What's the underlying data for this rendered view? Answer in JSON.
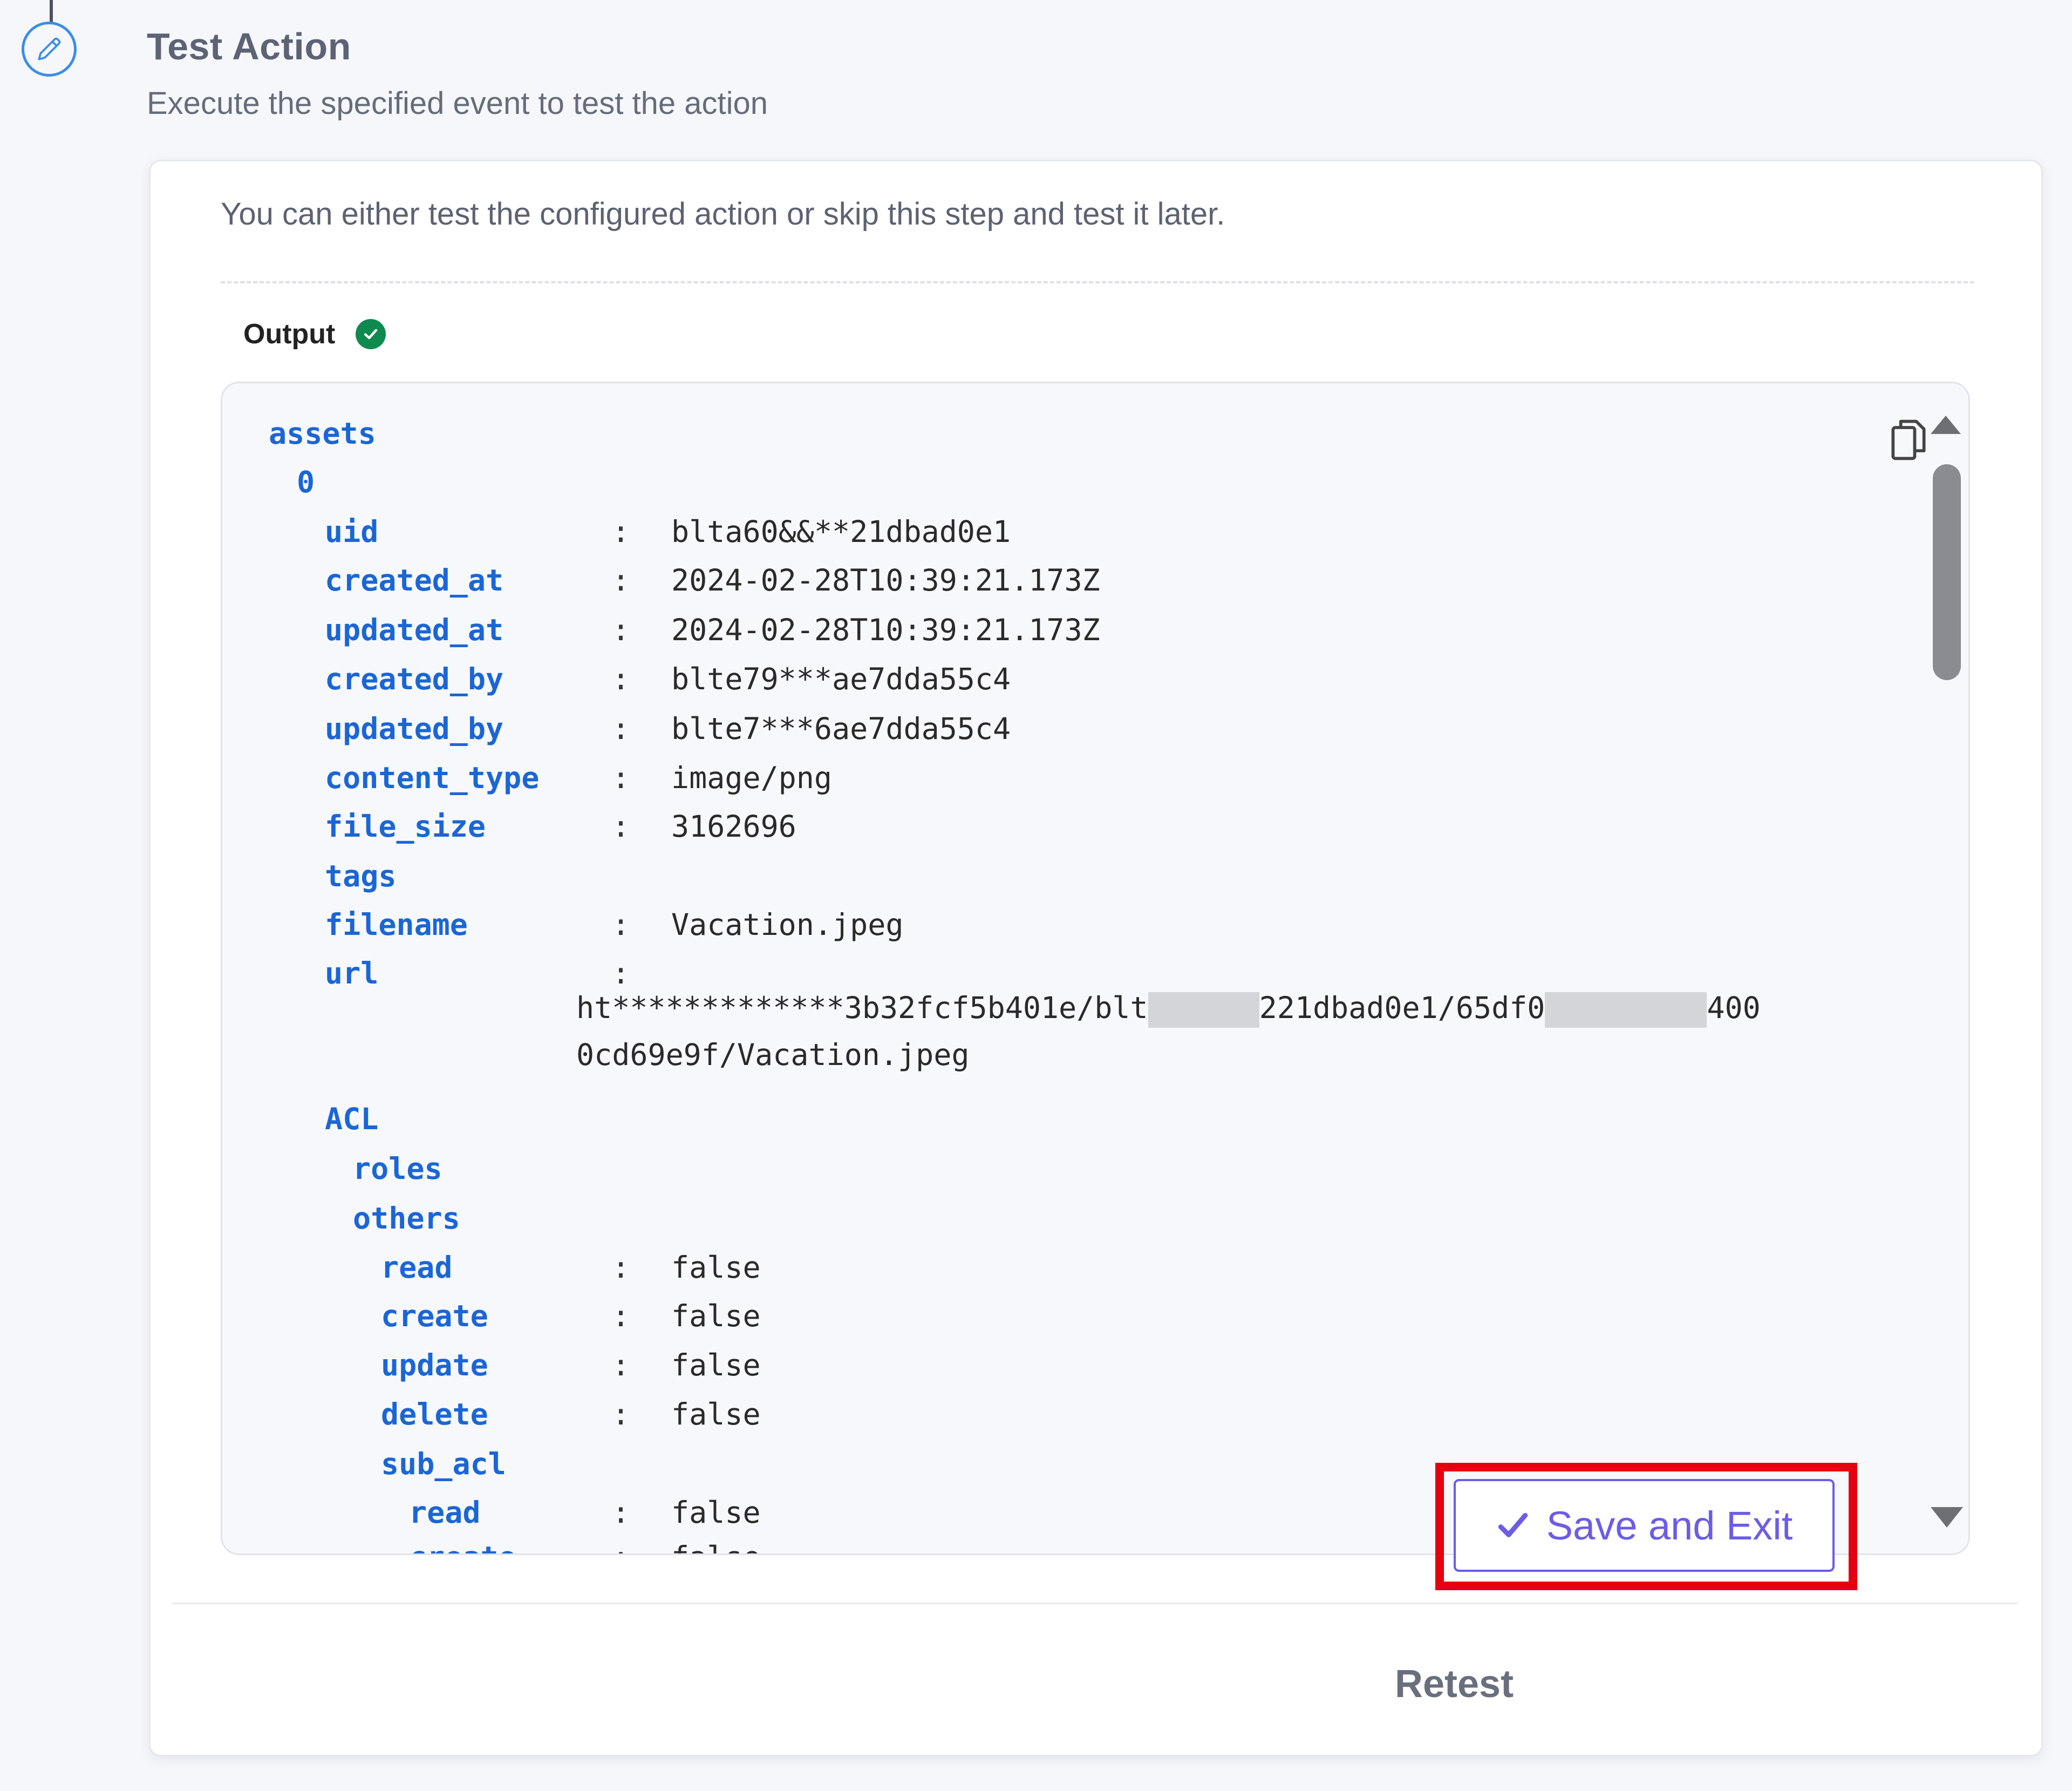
{
  "step": {
    "title": "Test Action",
    "subtitle": "Execute the specified event to test the action",
    "icon": "pencil-icon"
  },
  "card": {
    "intro": "You can either test the configured action or skip this step and test it later.",
    "output_label": "Output",
    "output_status": "success"
  },
  "output": {
    "rows": [
      {
        "key": "assets",
        "value": "",
        "indent": 0
      },
      {
        "key": "0",
        "value": "",
        "indent": 1
      },
      {
        "key": "uid",
        "value": "blta60&&**21dbad0e1",
        "indent": 2
      },
      {
        "key": "created_at",
        "value": "2024-02-28T10:39:21.173Z",
        "indent": 2
      },
      {
        "key": "updated_at",
        "value": "2024-02-28T10:39:21.173Z",
        "indent": 2
      },
      {
        "key": "created_by",
        "value": "blte79***ae7dda55c4",
        "indent": 2
      },
      {
        "key": "updated_by",
        "value": "blte7***6ae7dda55c4",
        "indent": 2
      },
      {
        "key": "content_type",
        "value": "image/png",
        "indent": 2
      },
      {
        "key": "file_size",
        "value": "3162696",
        "indent": 2
      },
      {
        "key": "tags",
        "value": "",
        "indent": 2
      },
      {
        "key": "filename",
        "value": "Vacation.jpeg",
        "indent": 2
      },
      {
        "key": "url",
        "value": "",
        "indent": 2
      },
      {
        "key": "ACL",
        "value": "",
        "indent": 2
      },
      {
        "key": "roles",
        "value": "",
        "indent": 3
      },
      {
        "key": "others",
        "value": "",
        "indent": 3
      },
      {
        "key": "read",
        "value": "false",
        "indent": 4
      },
      {
        "key": "create",
        "value": "false",
        "indent": 4
      },
      {
        "key": "update",
        "value": "false",
        "indent": 4
      },
      {
        "key": "delete",
        "value": "false",
        "indent": 4
      },
      {
        "key": "sub_acl",
        "value": "",
        "indent": 4
      },
      {
        "key": "read",
        "value": "false",
        "indent": 5
      },
      {
        "key": "create",
        "value": "false",
        "indent": 5
      }
    ],
    "url_line1_a": "ht*************3b32fcf5b401e/blt",
    "url_line1_b": "221dbad0e1/65df0",
    "url_line1_c": "400",
    "url_line2": "0cd69e9f/Vacation.jpeg"
  },
  "actions": {
    "retest_label": "Retest",
    "save_label": "Save and Exit"
  },
  "colors": {
    "key": "#1b66d6",
    "accent": "#6c5ce7",
    "success": "#0f8a4f",
    "highlight": "#e6000f"
  }
}
